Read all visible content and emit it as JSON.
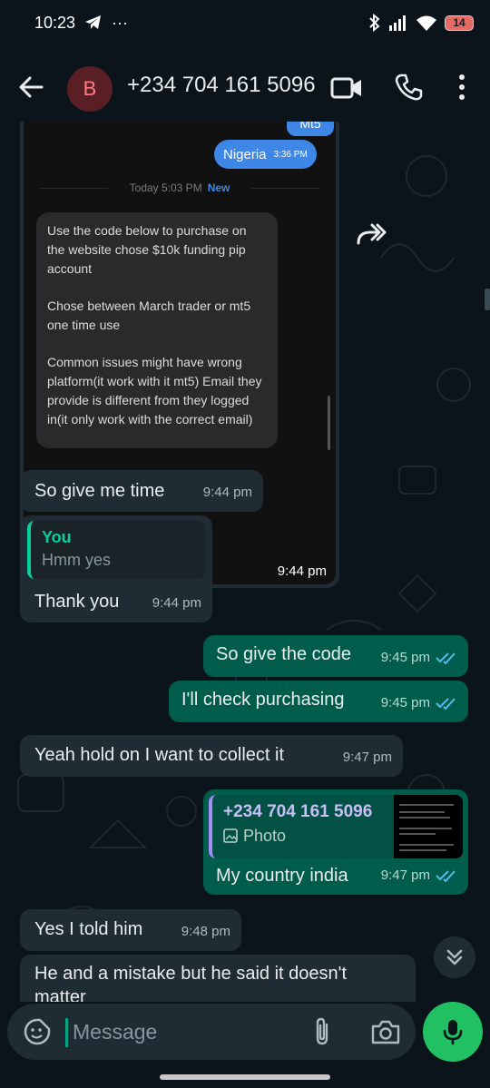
{
  "status_bar": {
    "time": "10:23",
    "dots": "···",
    "battery": "14"
  },
  "header": {
    "avatar_letter": "B",
    "contact": "+234 704 161 5096"
  },
  "screenshot": {
    "pill_top": "Mt5",
    "nigeria_text": "Nigeria",
    "nigeria_time": "3:36 PM",
    "divider_text": "Today 5:03 PM",
    "divider_new": "New",
    "paragraphs": [
      "Use the code below to purchase on the website chose $10k funding pip account",
      "Chose between March trader or mt5 one time use",
      "Common issues might have wrong platform(it work with it mt5) Email they provide is different from they logged in(it only work with the correct email)"
    ],
    "time": "9:44 pm"
  },
  "messages": {
    "m1": {
      "text": "So give me time",
      "time": "9:44 pm"
    },
    "m2": {
      "quote_name": "You",
      "quote_text": "Hmm yes",
      "text": "Thank you",
      "time": "9:44 pm"
    },
    "m3": {
      "text": "So give the code",
      "time": "9:45 pm"
    },
    "m4": {
      "text": "I'll check purchasing",
      "time": "9:45 pm"
    },
    "m5": {
      "text": "Yeah hold on I want to collect it",
      "time": "9:47 pm"
    },
    "m6": {
      "quote_name": "+234 704 161 5096",
      "quote_text": "Photo",
      "text": "My country india",
      "time": "9:47 pm"
    },
    "m7": {
      "text": "Yes I told him",
      "time": "9:48 pm"
    },
    "m8": {
      "text": "He and a mistake but he said it doesn't matter"
    }
  },
  "input": {
    "placeholder": "Message"
  },
  "colors": {
    "background": "#0b141a",
    "incoming": "#202c33",
    "outgoing": "#005c4b",
    "accent": "#21c063",
    "read_ticks": "#53bdeb"
  }
}
